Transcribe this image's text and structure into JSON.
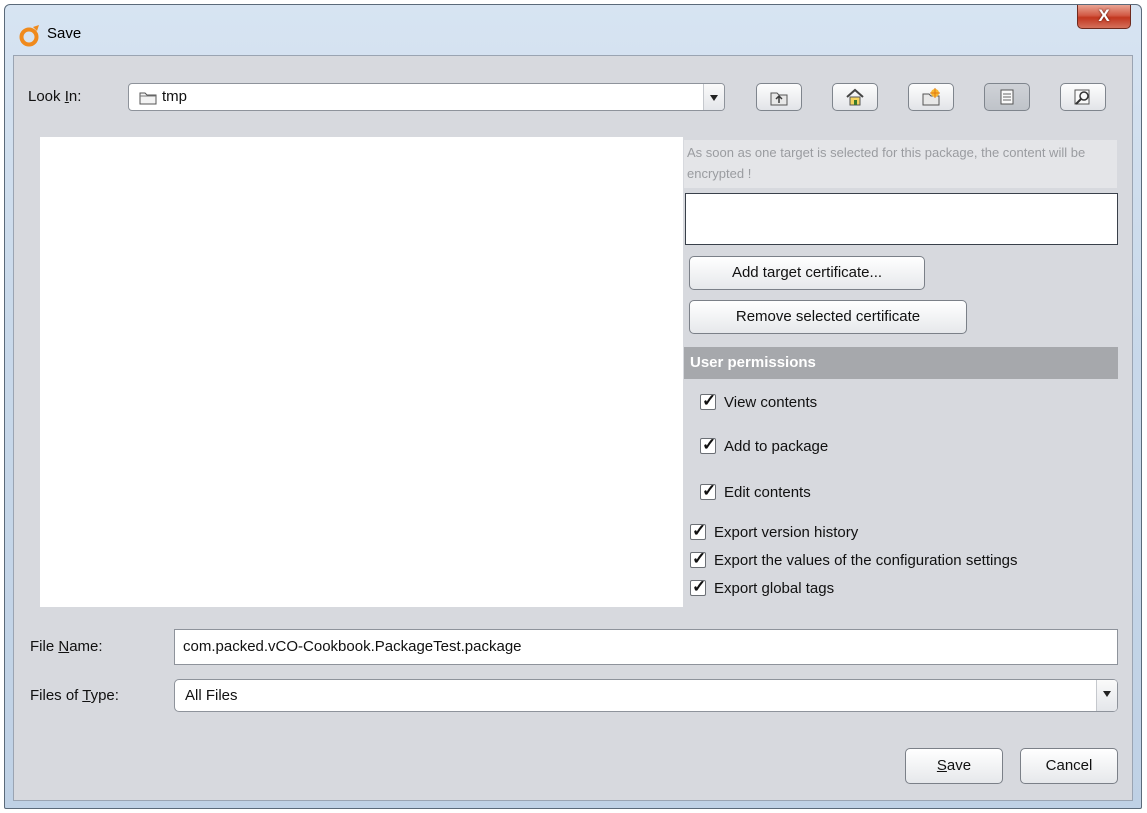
{
  "window": {
    "title": "Save",
    "close_glyph": "X"
  },
  "look_in": {
    "label_prefix": "Look ",
    "label_mnemonic": "I",
    "label_suffix": "n:",
    "value": "tmp"
  },
  "toolbar": {
    "icons": [
      "up-one-level-icon",
      "home-icon",
      "new-folder-icon",
      "list-view-icon",
      "details-view-icon"
    ]
  },
  "encryption": {
    "note": "As soon as one target is selected for this package, the content will be encrypted !",
    "add_button": "Add target certificate...",
    "remove_button": "Remove selected certificate"
  },
  "permissions": {
    "header": "User permissions",
    "items": [
      {
        "label": "View contents",
        "checked": true
      },
      {
        "label": "Add to package",
        "checked": true
      },
      {
        "label": "Edit contents",
        "checked": true
      },
      {
        "label": "Export version history",
        "checked": true
      },
      {
        "label": "Export the values of the configuration settings",
        "checked": true
      },
      {
        "label": "Export global tags",
        "checked": true
      }
    ]
  },
  "file_name": {
    "label_prefix": "File ",
    "label_mnemonic": "N",
    "label_suffix": "ame:",
    "value": "com.packed.vCO-Cookbook.PackageTest.package"
  },
  "file_type": {
    "label_prefix": "Files of ",
    "label_mnemonic": "T",
    "label_suffix": "ype:",
    "value": "All Files"
  },
  "actions": {
    "save_mnemonic": "S",
    "save_rest": "ave",
    "cancel": "Cancel"
  },
  "colors": {
    "accent_orange": "#f08a1c",
    "close_red": "#c9452f"
  }
}
